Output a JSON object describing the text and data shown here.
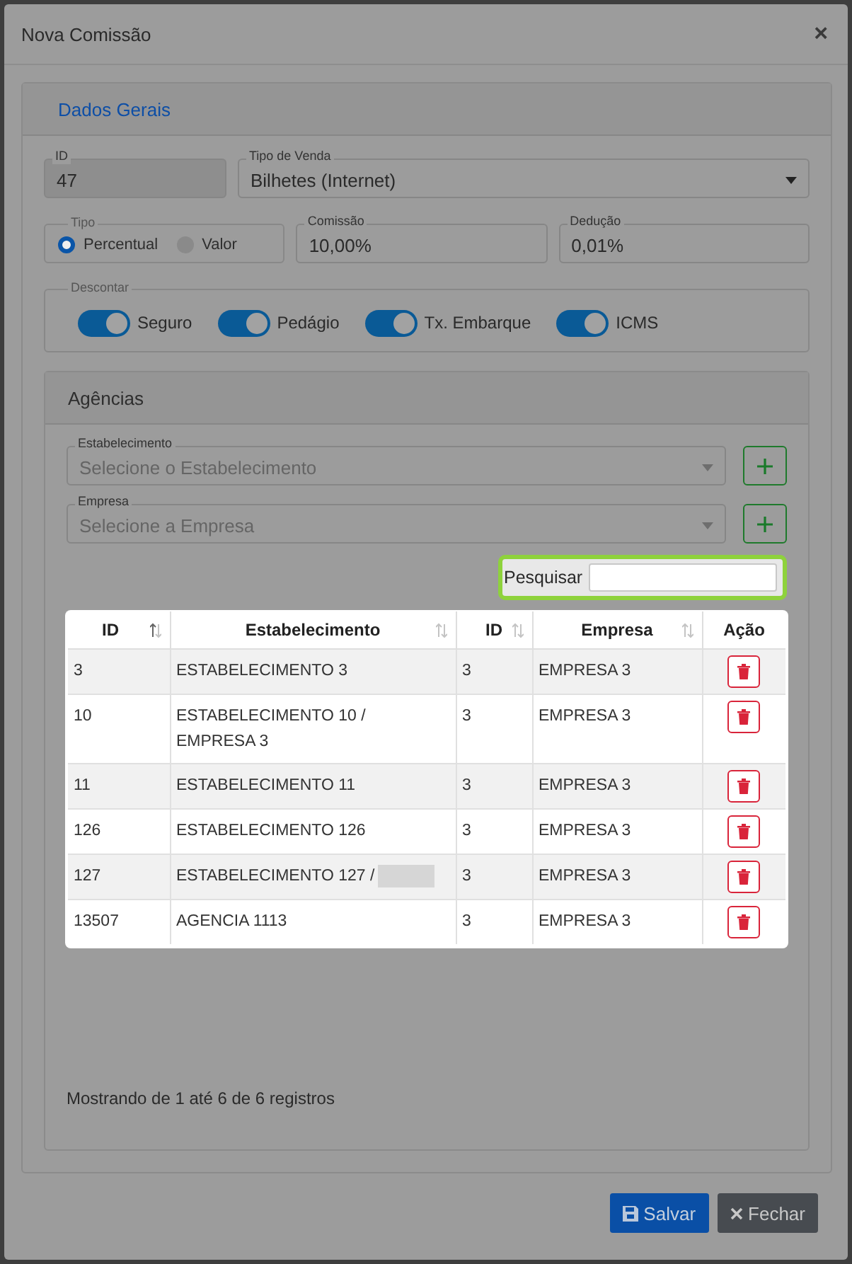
{
  "dialog": {
    "title": "Nova Comissão",
    "close": "×"
  },
  "general": {
    "tab": "Dados Gerais",
    "id": {
      "label": "ID",
      "value": "47",
      "disabled": true
    },
    "sale_type": {
      "label": "Tipo de Venda",
      "value": "Bilhetes (Internet)"
    },
    "type": {
      "label": "Tipo",
      "options": [
        {
          "label": "Percentual",
          "selected": true
        },
        {
          "label": "Valor",
          "selected": false
        }
      ]
    },
    "commission": {
      "label": "Comissão",
      "value": "10,00%"
    },
    "deduction": {
      "label": "Dedução",
      "value": "0,01%"
    },
    "discount": {
      "label": "Descontar",
      "toggles": [
        {
          "label": "Seguro",
          "on": true
        },
        {
          "label": "Pedágio",
          "on": true
        },
        {
          "label": "Tx. Embarque",
          "on": true
        },
        {
          "label": "ICMS",
          "on": true
        }
      ]
    }
  },
  "agencies": {
    "title": "Agências",
    "selects": [
      {
        "label": "Estabelecimento",
        "placeholder": "Selecione o Estabelecimento"
      },
      {
        "label": "Empresa",
        "placeholder": "Selecione a Empresa"
      }
    ],
    "search": {
      "label": "Pesquisar"
    },
    "table": {
      "columns": [
        {
          "label": "ID",
          "sortable": true
        },
        {
          "label": "Estabelecimento",
          "sortable": true
        },
        {
          "label": "ID",
          "sortable": true
        },
        {
          "label": "Empresa",
          "sortable": true
        },
        {
          "label": "Ação",
          "sortable": false
        }
      ],
      "rows": [
        {
          "cells": [
            "3",
            "ESTABELECIMENTO 3",
            "3",
            "EMPRESA 3"
          ]
        },
        {
          "cells": [
            "10",
            "ESTABELECIMENTO 10 / EMPRESA 3",
            "3",
            "EMPRESA 3"
          ]
        },
        {
          "cells": [
            "11",
            "ESTABELECIMENTO 11",
            "3",
            "EMPRESA 3"
          ]
        },
        {
          "cells": [
            "126",
            "ESTABELECIMENTO 126",
            "3",
            "EMPRESA 3"
          ]
        },
        {
          "cells": [
            "127",
            "ESTABELECIMENTO 127 /",
            "3",
            "EMPRESA 3"
          ],
          "redacted": true
        },
        {
          "cells": [
            "13507",
            "AGENCIA 1113",
            "3",
            "EMPRESA 3"
          ]
        }
      ]
    },
    "info": "Mostrando de 1 até 6 de 6 registros"
  },
  "buttons": [
    {
      "label": "Salvar",
      "kind": "primary"
    },
    {
      "label": "Fechar",
      "kind": "secondary"
    }
  ]
}
